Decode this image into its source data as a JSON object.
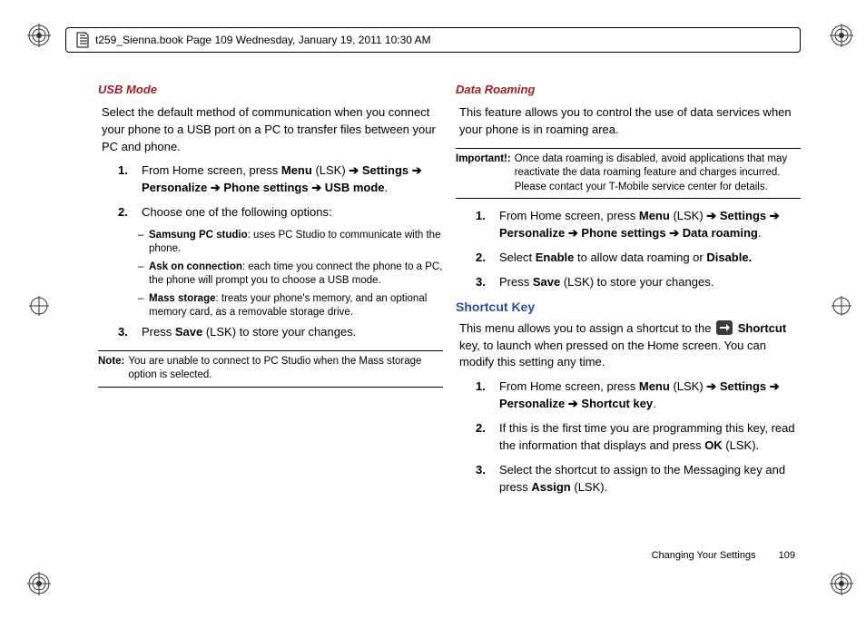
{
  "header": {
    "text": "t259_Sienna.book  Page 109  Wednesday, January 19, 2011  10:30 AM"
  },
  "left": {
    "heading": "USB Mode",
    "intro": "Select the default method of communication when you connect your phone to a USB port on a PC to transfer files between your PC and phone.",
    "step1_a": "From Home screen, press ",
    "step1_b": "Menu",
    "step1_c": " (LSK) ",
    "step1_d": "Settings",
    "step1_e": "Personalize",
    "step1_f": "Phone settings",
    "step1_g": "USB mode",
    "step2": "Choose one of the following options:",
    "opt1_b": "Samsung PC studio",
    "opt1_t": ": uses PC Studio to communicate with the phone.",
    "opt2_b": "Ask on connection",
    "opt2_t": ": each time you connect the phone to a PC, the phone will prompt you to choose a USB mode.",
    "opt3_b": "Mass storage",
    "opt3_t": ": treats your phone's memory, and an optional memory card, as a removable storage drive.",
    "step3_a": "Press ",
    "step3_b": "Save",
    "step3_c": " (LSK) to store your changes.",
    "note_label": "Note:",
    "note_text": "You are unable to connect to PC Studio when the Mass storage option is selected."
  },
  "right": {
    "heading1": "Data Roaming",
    "intro1": "This feature allows you to control the use of data services when your phone is in roaming area.",
    "imp_label": "Important!:",
    "imp_text": "Once data roaming is disabled, avoid applications that may reactivate the data roaming feature and charges incurred. Please contact your T-Mobile service center for details.",
    "r1_a": "From Home screen, press ",
    "r1_b": "Menu",
    "r1_c": " (LSK) ",
    "r1_d": "Settings",
    "r1_e": "Personalize",
    "r1_f": "Phone settings",
    "r1_g": "Data roaming",
    "r2_a": "Select ",
    "r2_b": "Enable",
    "r2_c": " to allow data roaming or ",
    "r2_d": "Disable.",
    "r3_a": "Press ",
    "r3_b": "Save",
    "r3_c": " (LSK) to store your changes.",
    "heading2": "Shortcut Key",
    "sk_intro_a": "This menu allows you to assign a shortcut to the ",
    "sk_intro_b": "Shortcut",
    "sk_intro_c": " key, to launch when pressed on the Home screen. You can modify this setting any time.",
    "s1_a": "From Home screen, press ",
    "s1_b": "Menu",
    "s1_c": " (LSK) ",
    "s1_d": "Settings",
    "s1_e": "Personalize",
    "s1_f": "Shortcut key",
    "s2_a": "If this is the first time you are programming this key, read the information that displays and press ",
    "s2_b": "OK",
    "s2_c": " (LSK).",
    "s3_a": "Select the shortcut to assign to the Messaging key and press ",
    "s3_b": "Assign",
    "s3_c": " (LSK)."
  },
  "footer": {
    "section": "Changing Your Settings",
    "page": "109"
  },
  "arrow": "➔"
}
